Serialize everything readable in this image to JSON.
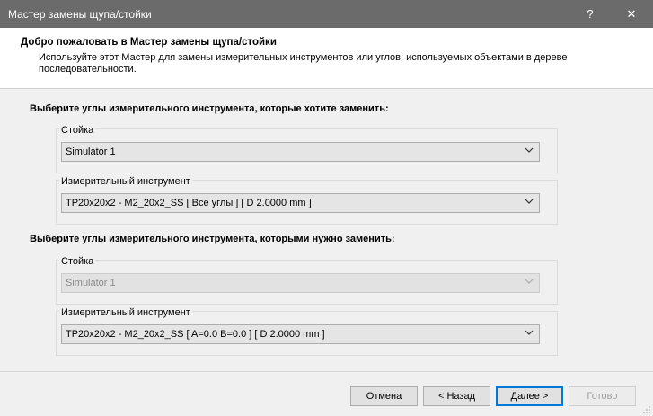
{
  "window": {
    "title": "Мастер замены щупа/стойки",
    "help_glyph": "?",
    "close_glyph": "✕"
  },
  "header": {
    "title": "Добро пожаловать в Мастер замены щупа/стойки",
    "description": "Используйте этот Мастер для замены измерительных инструментов или углов, используемых объектами в дереве последовательности."
  },
  "section_from": {
    "title": "Выберите углы измерительного инструмента, которые хотите заменить:",
    "stand_label": "Стойка",
    "stand_value": "Simulator 1",
    "tool_label": "Измерительный инструмент",
    "tool_value": "TP20x20x2 - M2_20x2_SS [ Все углы ] [ D 2.0000 mm ]"
  },
  "section_to": {
    "title": "Выберите углы измерительного инструмента, которыми нужно заменить:",
    "stand_label": "Стойка",
    "stand_value": "Simulator 1",
    "tool_label": "Измерительный инструмент",
    "tool_value": "TP20x20x2 - M2_20x2_SS [ A=0.0 B=0.0 ] [ D 2.0000 mm ]"
  },
  "buttons": {
    "cancel": "Отмена",
    "back": "< Назад",
    "next": "Далее >",
    "finish": "Готово"
  }
}
